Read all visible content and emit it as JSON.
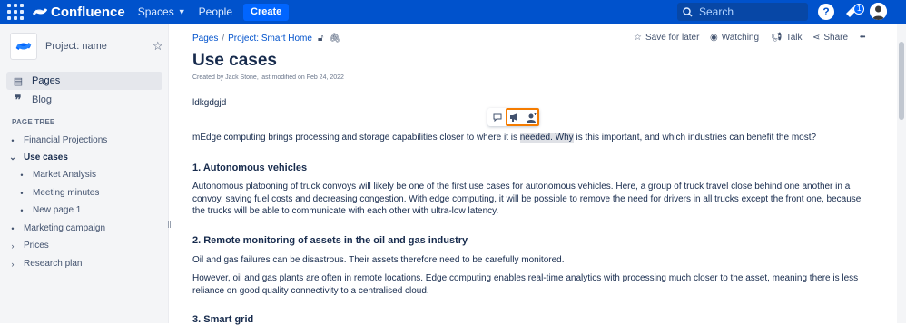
{
  "topnav": {
    "logo_text": "Confluence",
    "spaces_label": "Spaces",
    "people_label": "People",
    "create_label": "Create",
    "search_placeholder": "Search",
    "help_label": "?",
    "notification_count": "1",
    "brand_color": "#0052cc"
  },
  "sidebar": {
    "space_name": "Project: name",
    "pages_label": "Pages",
    "blog_label": "Blog",
    "pagetree_title": "PAGE TREE",
    "tree": [
      {
        "label": "Financial Projections",
        "marker": "•"
      },
      {
        "label": "Use cases",
        "marker": "⌄"
      },
      {
        "label": "Market Analysis",
        "marker": "•"
      },
      {
        "label": "Meeting minutes",
        "marker": "•"
      },
      {
        "label": "New page 1",
        "marker": "•"
      },
      {
        "label": "Marketing campaign",
        "marker": "•"
      },
      {
        "label": "Prices",
        "marker": "›"
      },
      {
        "label": "Research plan",
        "marker": "›"
      }
    ]
  },
  "page": {
    "breadcrumb": [
      "Pages",
      "/",
      "Project: Smart Home"
    ],
    "actions": {
      "save": "Save for later",
      "watching": "Watching",
      "talk": "Talk",
      "share": "Share",
      "more": "•••"
    },
    "title": "Use cases",
    "byline": "Created by Jack Stone, last modified on Feb 24, 2022",
    "para0": "ldkgdgjd",
    "intro_before": "mEdge computing brings processing and storage capabilities closer to where it is ",
    "intro_selected": "needed. Why",
    "intro_after": " is this important, and which industries can benefit the most?",
    "h1": "1. Autonomous vehicles",
    "p1": "Autonomous platooning of truck convoys will likely be one of the first use cases for autonomous vehicles. Here, a group of truck travel close behind one another in a convoy, saving fuel costs and decreasing congestion. With edge computing, it will be possible to remove the need for drivers in all trucks except the front one, because the trucks will be able to communicate with each other with ultra-low latency.",
    "h2": "2. Remote monitoring of assets in the oil and gas industry",
    "p2a": "Oil and gas failures can be disastrous. Their assets therefore need to be carefully monitored.",
    "p2b": "However, oil and gas plants are often in remote locations. Edge computing enables real-time analytics with processing much closer to the asset, meaning there is less reliance on good quality connectivity to a centralised cloud.",
    "h3": "3. Smart grid"
  },
  "inline_toolbar": {
    "icons": [
      "comment-icon",
      "megaphone-icon",
      "user-add-icon"
    ],
    "highlight_color": "#f57c00"
  }
}
